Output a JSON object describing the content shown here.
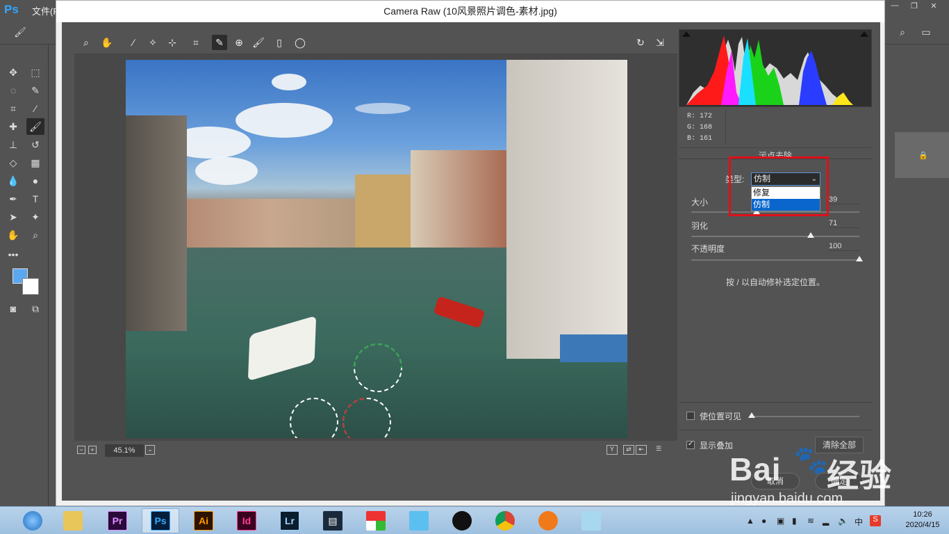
{
  "ps": {
    "logo": "Ps",
    "menu_first": "文件(F)"
  },
  "dialog": {
    "title": "Camera Raw (10风景照片调色-素材.jpg)"
  },
  "preview": {
    "zoom": "45.1%"
  },
  "readout": {
    "r": "R:  172",
    "g": "G:  168",
    "b": "B:  161"
  },
  "panel": {
    "title": "污点去除",
    "type_label": "类型:",
    "type_value": "仿制",
    "dropdown_options": [
      "修复",
      "仿制"
    ],
    "dropdown_selected_index": 1,
    "sliders": [
      {
        "label": "大小",
        "value": "39",
        "level": 0.39
      },
      {
        "label": "羽化",
        "value": "71",
        "level": 0.71
      },
      {
        "label": "不透明度",
        "value": "100",
        "level": 1.0
      }
    ],
    "hint": "按 / 以自动修补选定位置。",
    "visualize_label": "使位置可见",
    "overlay_label": "显示叠加",
    "clear_all": "清除全部",
    "cancel": "取消",
    "ok": "确定"
  },
  "watermark": {
    "brand": "Bai",
    "brand2": "经验",
    "url": "jingyan.baidu.com"
  },
  "taskbar": {
    "apps": [
      "Pr",
      "Ps",
      "Ai",
      "Id",
      "Lr"
    ],
    "time": "10:26",
    "date": "2020/4/15",
    "ime": "中"
  },
  "colors": {
    "highlight": "#e0101a",
    "foreground": "#5aa8f0",
    "selection": "#0a66cc"
  }
}
